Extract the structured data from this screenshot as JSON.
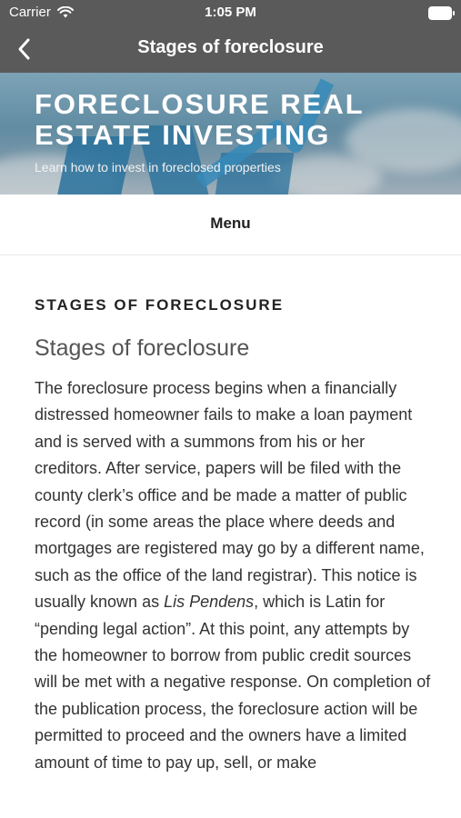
{
  "status_bar": {
    "carrier": "Carrier",
    "time": "1:05 PM"
  },
  "nav": {
    "title": "Stages of foreclosure"
  },
  "hero": {
    "site_title": "FORECLOSURE REAL ESTATE INVESTING",
    "tagline": "Learn how to invest in foreclosed properties"
  },
  "menu": {
    "label": "Menu"
  },
  "article": {
    "section_heading": "STAGES OF FORECLOSURE",
    "post_title": "Stages of foreclosure",
    "body_before_italic": "The foreclosure process begins when a financially distressed homeowner fails to make a loan payment and is served with a summons from his or her creditors. After service, papers will be filed with the county clerk’s office and be made a matter of public record (in some areas the place where deeds and mortgages are registered may go by a different name, such as the office of the land registrar). This notice is usually known as ",
    "body_italic": "Lis Pendens",
    "body_after_italic": ", which is Latin for “pending legal action”. At this point, any attempts by the homeowner to borrow from public credit sources will be met with a negative response. On completion of the publication process, the foreclosure action will be permitted to proceed and the owners have a limited amount of time to pay up, sell, or make"
  },
  "colors": {
    "nav_bg": "#5a5a5a",
    "link_blue": "#2d7fb0"
  }
}
